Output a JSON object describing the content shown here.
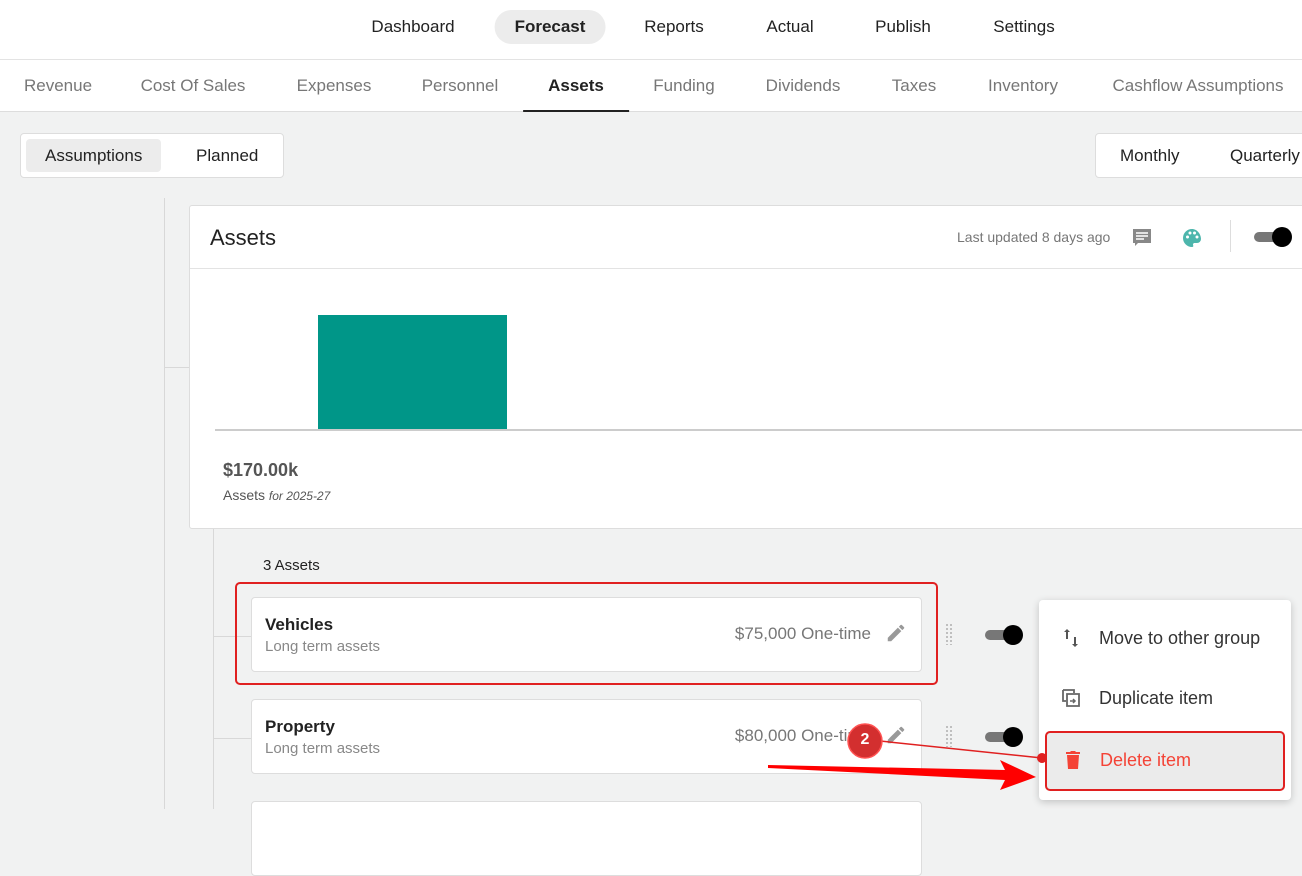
{
  "top_nav": {
    "items": [
      "Dashboard",
      "Forecast",
      "Reports",
      "Actual",
      "Publish",
      "Settings"
    ],
    "active": "Forecast"
  },
  "sub_nav": {
    "items": [
      "Revenue",
      "Cost Of Sales",
      "Expenses",
      "Personnel",
      "Assets",
      "Funding",
      "Dividends",
      "Taxes",
      "Inventory",
      "Cashflow Assumptions"
    ],
    "active": "Assets"
  },
  "view_toggle": {
    "assumptions": "Assumptions",
    "planned": "Planned"
  },
  "period_toggle": {
    "monthly": "Monthly",
    "quarterly": "Quarterly"
  },
  "card": {
    "title": "Assets",
    "last_updated": "Last updated 8 days ago",
    "total": "$170.00k",
    "total_label": "Assets",
    "total_period": "for 2025-27"
  },
  "chart_data": {
    "type": "bar",
    "categories": [
      "2025-27"
    ],
    "values": [
      170000
    ],
    "color": "#009688"
  },
  "list": {
    "count_label": "3 Assets",
    "items": [
      {
        "name": "Vehicles",
        "category": "Long term assets",
        "amount": "$75,000 One-time"
      },
      {
        "name": "Property",
        "category": "Long term assets",
        "amount": "$80,000 One-time"
      }
    ]
  },
  "context_menu": {
    "move": "Move to other group",
    "duplicate": "Duplicate item",
    "delete": "Delete item"
  },
  "annotation": {
    "step": "2"
  },
  "colors": {
    "accent": "#009688",
    "danger": "#f44336",
    "annotation": "#e02020"
  }
}
